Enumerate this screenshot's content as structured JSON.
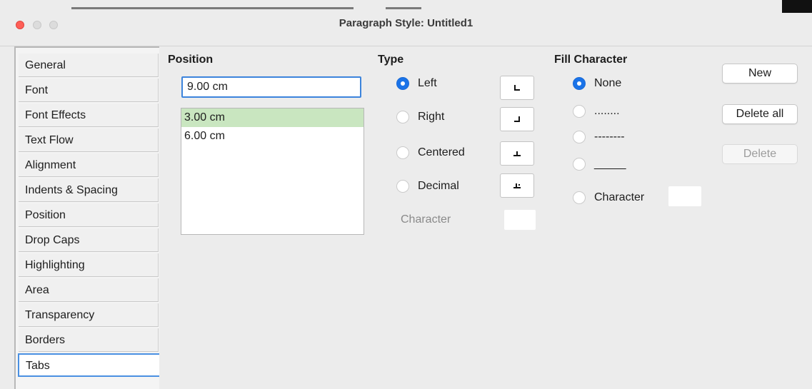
{
  "window": {
    "title": "Paragraph Style: Untitled1"
  },
  "sidebar": {
    "items": [
      {
        "label": "General"
      },
      {
        "label": "Font"
      },
      {
        "label": "Font Effects"
      },
      {
        "label": "Text Flow"
      },
      {
        "label": "Alignment"
      },
      {
        "label": "Indents & Spacing"
      },
      {
        "label": "Position"
      },
      {
        "label": "Drop Caps"
      },
      {
        "label": "Highlighting"
      },
      {
        "label": "Area"
      },
      {
        "label": "Transparency"
      },
      {
        "label": "Borders"
      },
      {
        "label": "Tabs",
        "active": true
      }
    ]
  },
  "position": {
    "heading": "Position",
    "value": "9.00 cm",
    "list": [
      "3.00 cm",
      "6.00 cm"
    ],
    "selected_index": 0
  },
  "type": {
    "heading": "Type",
    "options": [
      {
        "label": "Left",
        "checked": true,
        "icon": "tab-left-icon"
      },
      {
        "label": "Right",
        "checked": false,
        "icon": "tab-right-icon"
      },
      {
        "label": "Centered",
        "checked": false,
        "icon": "tab-center-icon"
      },
      {
        "label": "Decimal",
        "checked": false,
        "icon": "tab-decimal-icon"
      }
    ],
    "character_label": "Character",
    "character_value": ""
  },
  "fill": {
    "heading": "Fill Character",
    "options": [
      {
        "label": "None",
        "checked": true
      },
      {
        "label": "........",
        "checked": false
      },
      {
        "label": "--------",
        "checked": false
      },
      {
        "label": "_____",
        "checked": false
      },
      {
        "label": "Character",
        "checked": false
      }
    ],
    "character_value": ""
  },
  "buttons": {
    "new": "New",
    "delete_all": "Delete all",
    "delete": "Delete"
  },
  "colors": {
    "accent": "#1a73e8",
    "selection": "#c9e6c0",
    "close": "#fe5f57"
  }
}
